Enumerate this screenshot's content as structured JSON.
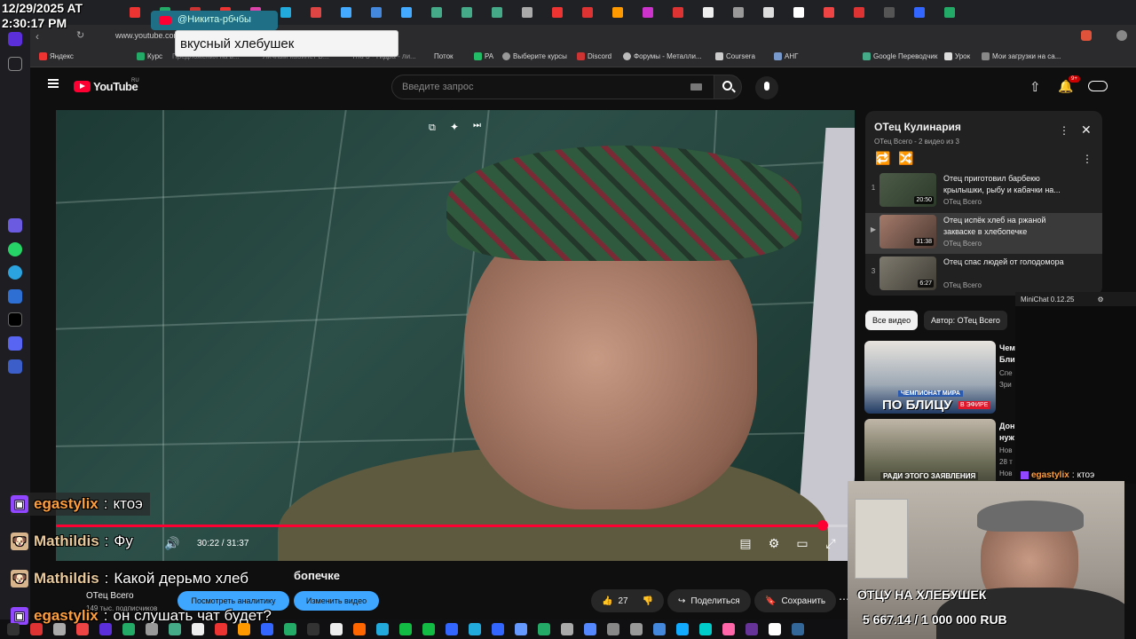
{
  "stream_overlay": {
    "clock_date": "12/29/2025 AT",
    "clock_time": "2:30:17 PM",
    "alert_user": "@Никита-рбчбы",
    "alert_message": "вкусный хлебушек",
    "chat": [
      {
        "user": "egastylix",
        "message": "ктоэ",
        "user_color": "#ff9e3d",
        "badge": "twitch"
      },
      {
        "user": "Mathildis",
        "message": "Фу",
        "user_color": "#e7c89a",
        "badge": "dog"
      },
      {
        "user": "Mathildis",
        "message": "Какой дерьмо хлеб",
        "user_color": "#e7c89a",
        "badge": "dog"
      },
      {
        "user": "egastylix",
        "message": "он слушать чат будет?",
        "user_color": "#ff9e3d",
        "badge": "twitch"
      }
    ],
    "cam_chat_user": "egastylix",
    "cam_chat_message": "ктоэ",
    "goal_title": "ОТЦУ НА ХЛЕБУШЕК",
    "goal_amount": "5 667.14 / 1 000 000 RUB",
    "minichat_title": "MiniChat 0.12.25"
  },
  "browser": {
    "url": "www.youtube.com",
    "bookmarks": [
      "Яндекс",
      "Курс",
      "Предложения на в...",
      "Личный кабинет В...",
      "Т/КГЗ - Гидра - ли...",
      "Поток",
      "PA",
      "Выберите курсы",
      "Discord",
      "Форумы - Металли...",
      "Coursera",
      "АНГ",
      "Google Переводчик",
      "Урок",
      "Мои загрузки на са..."
    ]
  },
  "youtube": {
    "logo": "YouTube",
    "logo_region": "RU",
    "search_placeholder": "Введите запрос",
    "notifications_count": "9+",
    "player": {
      "time": "30:22 / 31:37",
      "progress": 0.96
    },
    "video_title": "Отец испёк хлеб на ржаной закваске в хлебопечке",
    "video_title_visible": "бопечке",
    "channel": "ОТец Всего",
    "subscribers": "149 тыс. подписчиков",
    "analytics_button": "Посмотреть аналитику",
    "edit_button": "Изменить видео",
    "likes": "27",
    "share_label": "Поделиться",
    "save_label": "Сохранить",
    "playlist": {
      "title": "ОТец Кулинария",
      "subtitle": "ОТец Всего - 2 видео из 3",
      "items": [
        {
          "index": "1",
          "title": "Отец приготовил барбекю крылышки, рыбу и кабачки на...",
          "channel": "ОТец Всего",
          "duration": "20:50"
        },
        {
          "index": "▶",
          "title": "Отец испёк хлеб на ржаной закваске в хлебопечке",
          "channel": "ОТец Всего",
          "duration": "31:38"
        },
        {
          "index": "3",
          "title": "Отец спас людей от голодомора",
          "channel": "ОТец Всего",
          "duration": "6:27"
        }
      ]
    },
    "chips": [
      "Все видео",
      "Автор: ОТец Всего"
    ],
    "recommendations": [
      {
        "thumb_text": "ПО БЛИЦУ",
        "thumb_badge": "В ЭФИРЕ",
        "thumb_banner": "ЧЕМПИОНАТ МИРА",
        "title_snip": "Чем Бли",
        "meta_snip": "Спе Зри"
      },
      {
        "thumb_text": "РАДИ ЭТОГО ЗАЯВЛЕНИЯ",
        "title_snip": "Дон нуж",
        "meta_snip": "Нов 28 т Нов"
      }
    ]
  },
  "colors": {
    "yt_red": "#ff0033",
    "accent_blue": "#3ea6ff",
    "panel": "#212121"
  }
}
